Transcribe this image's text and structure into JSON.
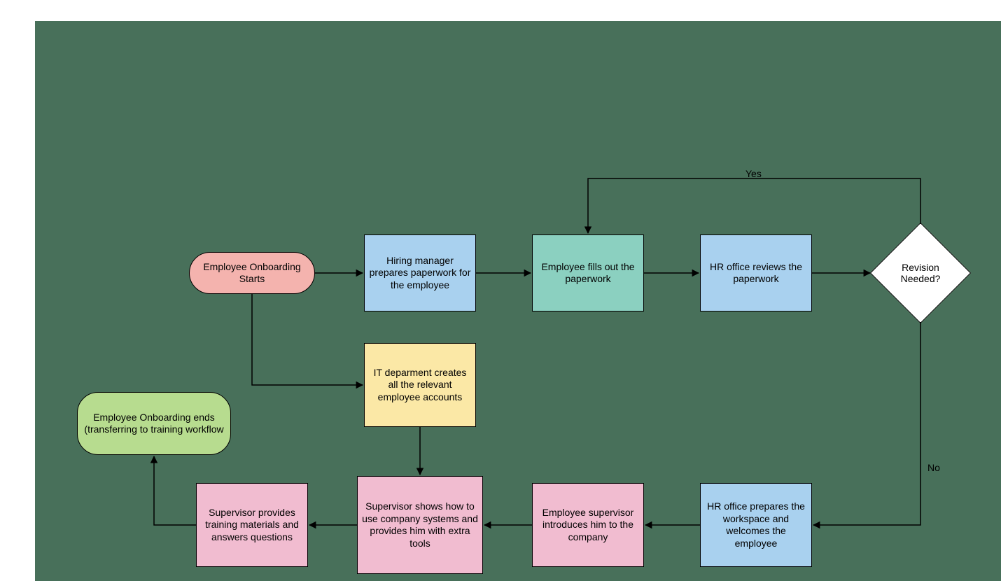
{
  "chart_data": {
    "type": "flowchart",
    "nodes": [
      {
        "id": "start",
        "shape": "terminator",
        "color": "#f4b3ae",
        "text": "Employee Onboarding Starts"
      },
      {
        "id": "hiring",
        "shape": "process",
        "color": "#a9d1ef",
        "text": "Hiring manager prepares paperwork for the employee"
      },
      {
        "id": "fills",
        "shape": "process",
        "color": "#8bd0c0",
        "text": "Employee fills out the paperwork"
      },
      {
        "id": "reviews",
        "shape": "process",
        "color": "#a9d1ef",
        "text": "HR office reviews the paperwork"
      },
      {
        "id": "decision",
        "shape": "decision",
        "color": "#ffffff",
        "text": "Revision Needed?"
      },
      {
        "id": "it",
        "shape": "process",
        "color": "#fbe8a6",
        "text": "IT deparment creates all the relevant employee accounts"
      },
      {
        "id": "prepares",
        "shape": "process",
        "color": "#a9d1ef",
        "text": "HR office prepares the workspace and welcomes the employee"
      },
      {
        "id": "introduces",
        "shape": "process",
        "color": "#f1bcd0",
        "text": "Employee supervisor introduces him to the company"
      },
      {
        "id": "shows",
        "shape": "process",
        "color": "#f1bcd0",
        "text": "Supervisor shows how to use company systems and provides him with extra tools"
      },
      {
        "id": "training",
        "shape": "process",
        "color": "#f1bcd0",
        "text": "Supervisor provides training materials and answers questions"
      },
      {
        "id": "end",
        "shape": "terminator",
        "color": "#b7dc8f",
        "text": "Employee Onboarding ends (transferring to training workflow"
      }
    ],
    "edges": [
      {
        "from": "start",
        "to": "hiring"
      },
      {
        "from": "hiring",
        "to": "fills"
      },
      {
        "from": "fills",
        "to": "reviews"
      },
      {
        "from": "reviews",
        "to": "decision"
      },
      {
        "from": "decision",
        "to": "fills",
        "label": "Yes"
      },
      {
        "from": "decision",
        "to": "prepares",
        "label": "No"
      },
      {
        "from": "start",
        "to": "it"
      },
      {
        "from": "it",
        "to": "shows"
      },
      {
        "from": "prepares",
        "to": "introduces"
      },
      {
        "from": "introduces",
        "to": "shows"
      },
      {
        "from": "shows",
        "to": "training"
      },
      {
        "from": "training",
        "to": "end"
      }
    ]
  },
  "labels": {
    "yes": "Yes",
    "no": "No"
  }
}
